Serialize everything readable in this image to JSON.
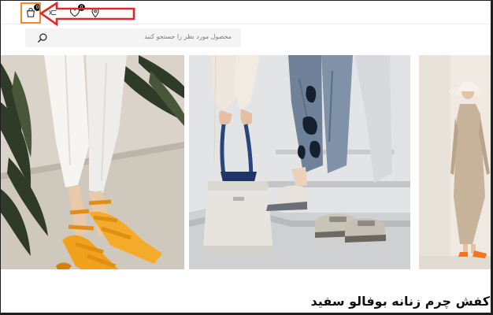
{
  "header": {
    "cart": {
      "icon": "shopping-bag-icon",
      "count": "0"
    },
    "wishlist": {
      "icon": "heart-icon",
      "count": "0"
    },
    "store_locator": {
      "icon": "map-pin-icon"
    },
    "compare": {
      "icon": "shuffle-icon"
    }
  },
  "annotation": {
    "highlight_color": "#f2872c",
    "arrow_color": "#e0282b"
  },
  "search": {
    "placeholder": "محصول مورد نظر را جستجو کنید",
    "icon": "search-icon"
  },
  "gallery": {
    "images": [
      {
        "alt": "orange strappy sandals on stairs"
      },
      {
        "alt": "white handbag and loafers on steps"
      },
      {
        "alt": "model in beige dress with hat"
      }
    ]
  },
  "product": {
    "title": "کفش چرم زنانه بوفالو سفید"
  }
}
